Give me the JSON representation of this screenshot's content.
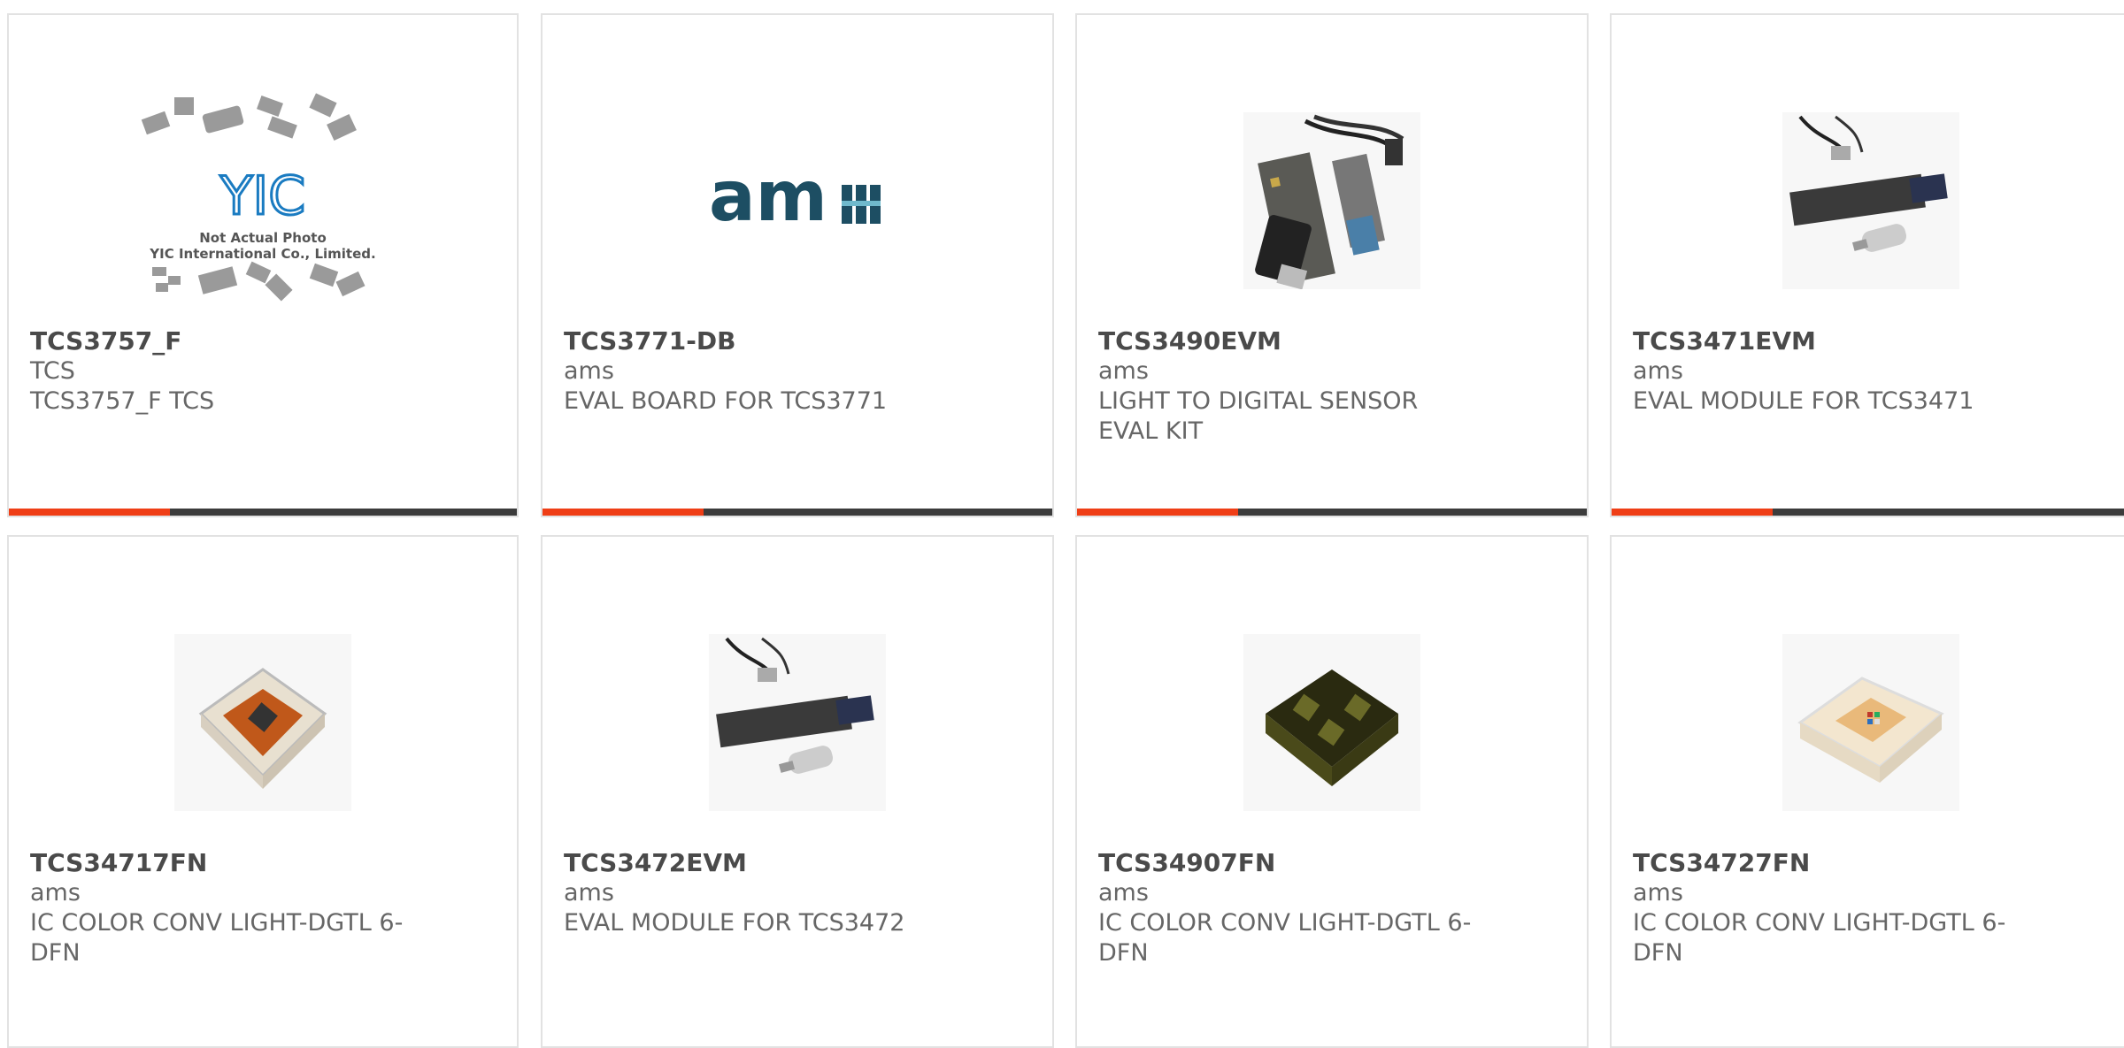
{
  "colors": {
    "accent": "#ef3e16",
    "bar": "#3c3c3c",
    "border": "#e2e2e2",
    "ams_logo": "#1d4e63",
    "yic_logo": "#1a7bc1"
  },
  "products": [
    {
      "part_number": "TCS3757_F",
      "manufacturer": "TCS",
      "description": "TCS3757_F TCS",
      "image": "not-actual-photo",
      "image_text_line1": "Not Actual Photo",
      "image_text_line2": "YIC International Co., Limited.",
      "logo_text": "YIC"
    },
    {
      "part_number": "TCS3771-DB",
      "manufacturer": "ams",
      "description": "EVAL BOARD FOR TCS3771",
      "image": "ams-logo",
      "logo_text": "am"
    },
    {
      "part_number": "TCS3490EVM",
      "manufacturer": "ams",
      "description": "LIGHT TO DIGITAL SENSOR EVAL KIT",
      "image": "eval-kit-usb"
    },
    {
      "part_number": "TCS3471EVM",
      "manufacturer": "ams",
      "description": "EVAL MODULE FOR TCS3471",
      "image": "eval-module-board"
    },
    {
      "part_number": "TCS34717FN",
      "manufacturer": "ams",
      "description": "IC COLOR CONV LIGHT-DGTL 6-DFN",
      "image": "dfn-chip-orange"
    },
    {
      "part_number": "TCS3472EVM",
      "manufacturer": "ams",
      "description": "EVAL MODULE FOR TCS3472",
      "image": "eval-module-board"
    },
    {
      "part_number": "TCS34907FN",
      "manufacturer": "ams",
      "description": "IC COLOR CONV LIGHT-DGTL 6-DFN",
      "image": "dfn-chip-dark"
    },
    {
      "part_number": "TCS34727FN",
      "manufacturer": "ams",
      "description": "IC COLOR CONV LIGHT-DGTL 6-DFN",
      "image": "dfn-chip-clear"
    }
  ]
}
